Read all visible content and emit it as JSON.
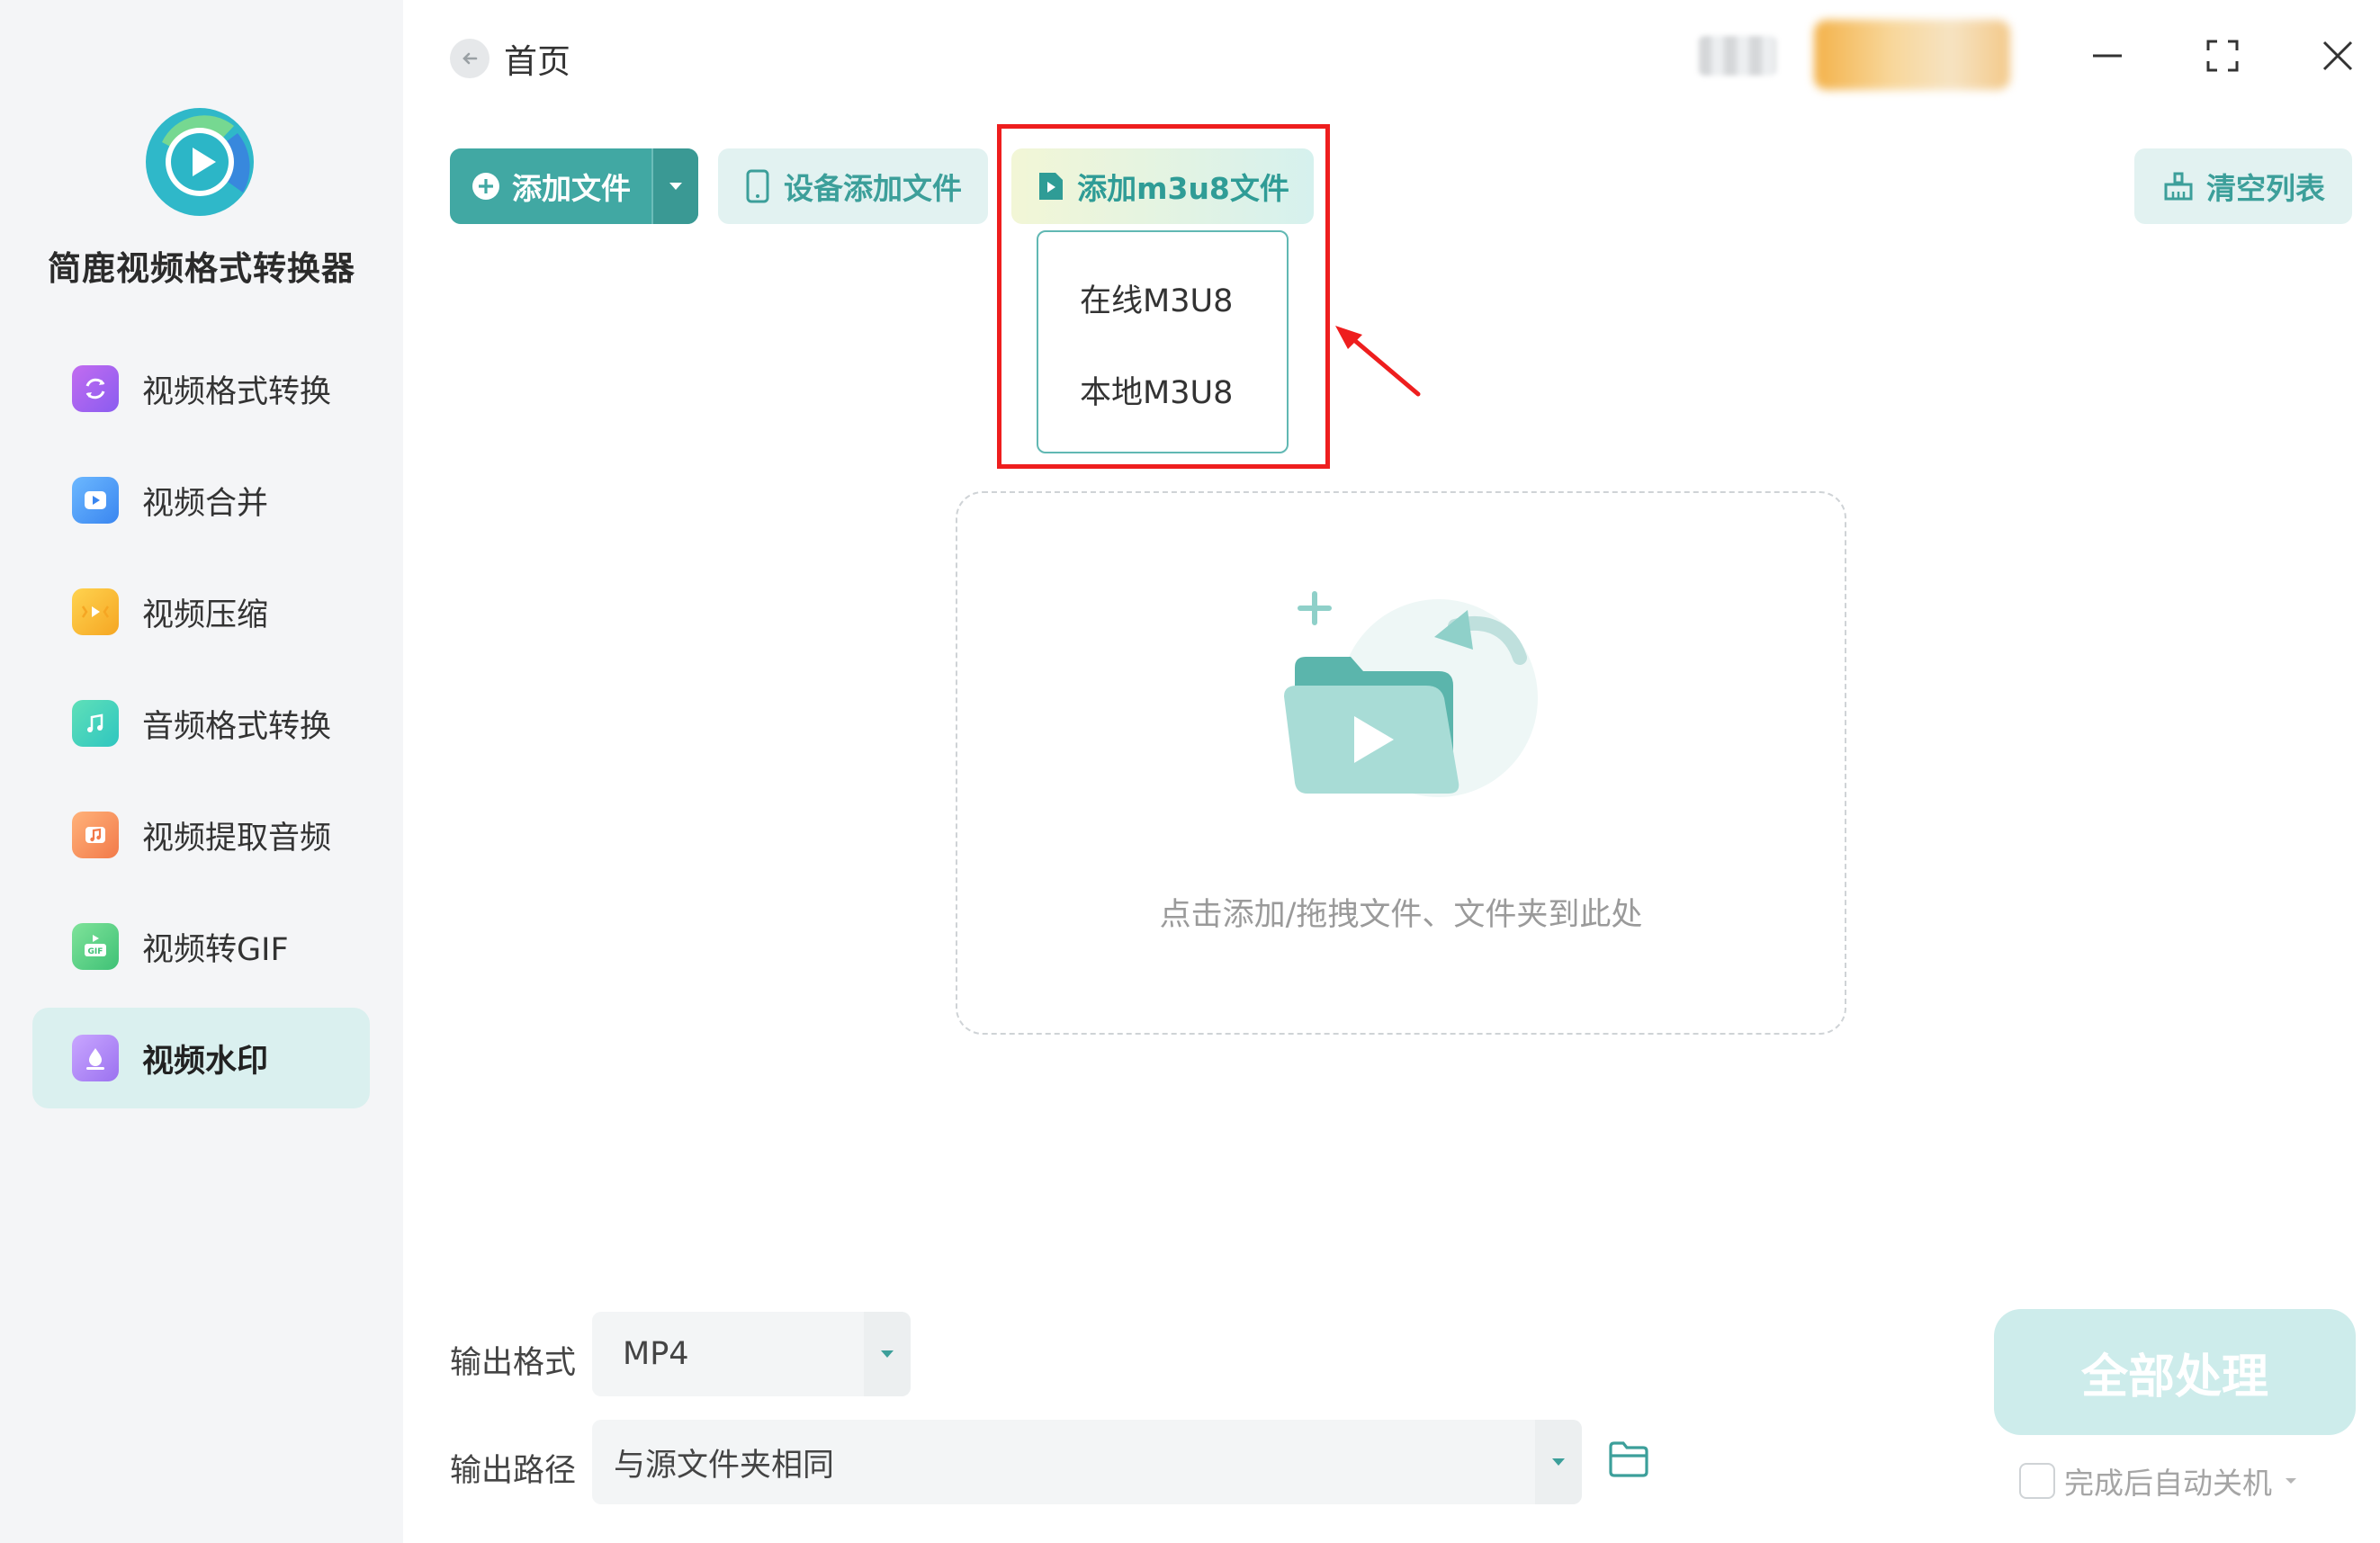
{
  "app": {
    "name": "简鹿视频格式转换器"
  },
  "sidebar": {
    "items": [
      {
        "label": "视频格式转换",
        "icon": "video-convert-icon"
      },
      {
        "label": "视频合并",
        "icon": "video-merge-icon"
      },
      {
        "label": "视频压缩",
        "icon": "video-compress-icon"
      },
      {
        "label": "音频格式转换",
        "icon": "audio-convert-icon"
      },
      {
        "label": "视频提取音频",
        "icon": "extract-audio-icon"
      },
      {
        "label": "视频转GIF",
        "icon": "gif-icon"
      },
      {
        "label": "视频水印",
        "icon": "watermark-icon",
        "active": true
      }
    ]
  },
  "header": {
    "home_label": "首页"
  },
  "toolbar": {
    "add_file": "添加文件",
    "device_add": "设备添加文件",
    "add_m3u8": "添加m3u8文件",
    "clear_list": "清空列表"
  },
  "m3u8_menu": {
    "items": [
      "在线M3U8",
      "本地M3U8"
    ]
  },
  "drop_area": {
    "hint": "点击添加/拖拽文件、文件夹到此处"
  },
  "output": {
    "format_label": "输出格式",
    "format_value": "MP4",
    "path_label": "输出路径",
    "path_value": "与源文件夹相同"
  },
  "actions": {
    "process_all": "全部处理",
    "shutdown_label": "完成后自动关机",
    "shutdown_checked": false
  },
  "colors": {
    "accent": "#41a8a3",
    "accent_light": "#e2f2f1",
    "highlight": "#ee1e1e",
    "sidebar_active": "#daf0ef"
  }
}
